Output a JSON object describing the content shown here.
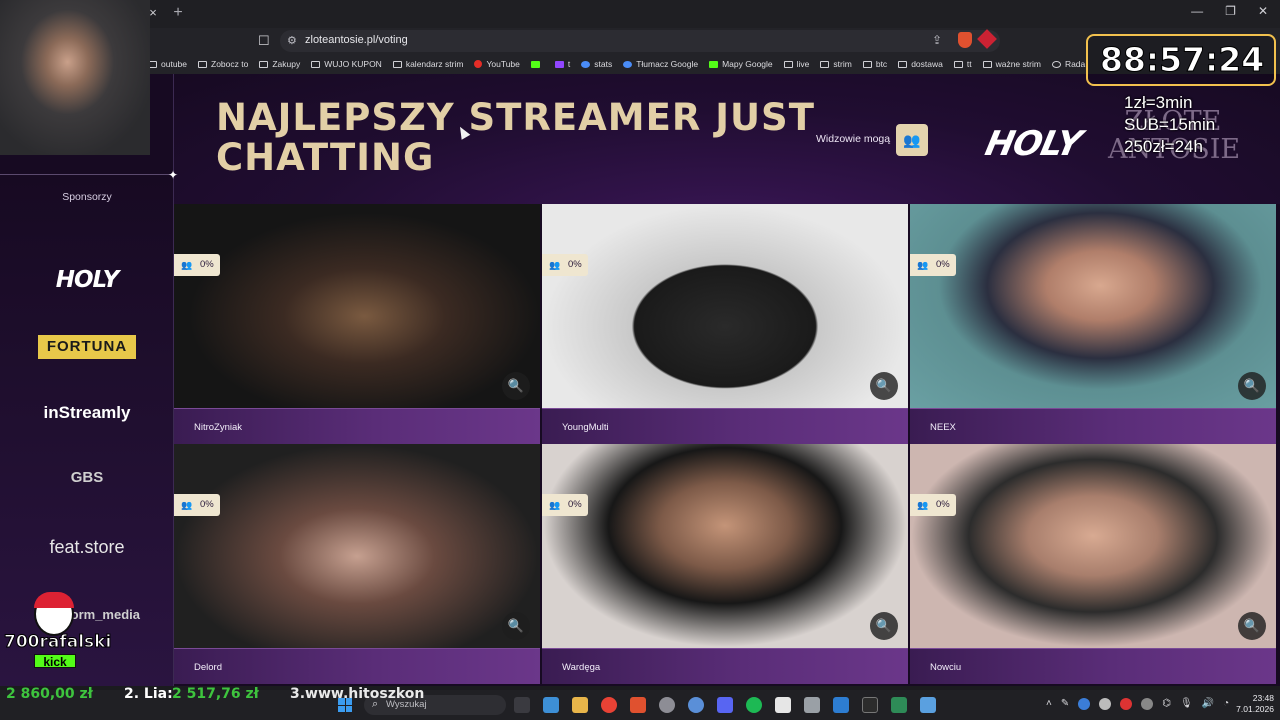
{
  "browser": {
    "close_glyph": "×",
    "new_tab_glyph": "+",
    "window_controls": [
      "—",
      "❐",
      "✕"
    ],
    "url": "zloteantosie.pl/voting",
    "bookmarks": [
      {
        "label": "outube",
        "icon": "folder-icon"
      },
      {
        "label": "Zobocz to",
        "icon": "folder-icon"
      },
      {
        "label": "Zakupy",
        "icon": "folder-icon"
      },
      {
        "label": "WUJO KUPON",
        "icon": "folder-icon"
      },
      {
        "label": "kalendarz strim",
        "icon": "folder-icon"
      },
      {
        "label": "YouTube",
        "icon": "youtube-icon"
      },
      {
        "label": "",
        "icon": "kick-icon"
      },
      {
        "label": "t",
        "icon": "twitch-icon"
      },
      {
        "label": "stats",
        "icon": "stats-icon"
      },
      {
        "label": "Tłumacz Google",
        "icon": "translate-icon"
      },
      {
        "label": "Mapy Google",
        "icon": "maps-icon"
      },
      {
        "label": "live",
        "icon": "folder-icon"
      },
      {
        "label": "strim",
        "icon": "folder-icon"
      },
      {
        "label": "btc",
        "icon": "folder-icon"
      },
      {
        "label": "dostawa",
        "icon": "folder-icon"
      },
      {
        "label": "tt",
        "icon": "folder-icon"
      },
      {
        "label": "ważne strim",
        "icon": "folder-icon"
      },
      {
        "label": "Rada",
        "icon": "globe-icon"
      }
    ],
    "bookmarks_more": "»"
  },
  "page": {
    "title": "NAJLEPSZY STREAMER JUST CHATTING",
    "viewers_label": "Widzowie mogą",
    "hero_logo": "HOLY",
    "hero_logo_secondary": "ZŁOTE ANTOSIE",
    "sidebar": {
      "heading": "Sponsorzy",
      "sponsors": [
        "HOLY",
        "FORTUNA",
        "inStreamly",
        "GBS",
        "feat.store",
        "storm_media"
      ]
    },
    "cards": [
      {
        "name": "NitroZyniak",
        "percent": "0%"
      },
      {
        "name": "YoungMulti",
        "percent": "0%"
      },
      {
        "name": "NEEX",
        "percent": "0%"
      },
      {
        "name": "Delord",
        "percent": "0%"
      },
      {
        "name": "Wardęga",
        "percent": "0%"
      },
      {
        "name": "Nowciu",
        "percent": "0%"
      }
    ]
  },
  "overlay": {
    "timer": "88:57:24",
    "rates": [
      "1zł=3min",
      "SUB=15min",
      "250zł=24h"
    ],
    "mascot_label": "700rafalski",
    "mascot_badge": "kick",
    "ticker": {
      "first": "2 860,00 zł",
      "second_name": "2. Lia:",
      "second_amount": "2 517,76 zł",
      "third": "3.www.hitoszkon"
    }
  },
  "taskbar": {
    "search_placeholder": "Wyszukaj",
    "time": "23:48",
    "date": "7.01.2026"
  },
  "colors": {
    "accent_gold": "#e2cfa6",
    "card_bar": "#5a2d78",
    "timer_border": "#f2c14e",
    "ticker_green": "#3ec43e"
  }
}
